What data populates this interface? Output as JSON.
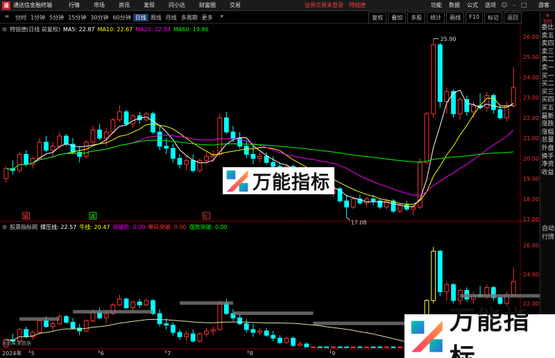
{
  "titlebar": {
    "app_title": "通达信金融终端",
    "menus": [
      "行情",
      "市场",
      "资讯",
      "发现",
      "问小达",
      "财富圈",
      "交易"
    ],
    "notice": "证券交易未登录",
    "notice2": "特锐德",
    "right_menus": [
      "功能",
      "数据",
      "公式",
      "选项"
    ],
    "guest": "游客"
  },
  "toolbar": {
    "periods": [
      "分时",
      "1分钟",
      "5分钟",
      "15分钟",
      "30分钟",
      "60分钟",
      "日线",
      "周线",
      "月线",
      "多周期",
      "更多"
    ],
    "active_period": "日线",
    "right_tools": [
      "复权",
      "叠加",
      "多股",
      "统计",
      "画线",
      "F10",
      "标记",
      "返回"
    ]
  },
  "main_legend": {
    "stock": "特锐德(日线 前复权)",
    "ma5": "MA5: 22.87",
    "ma10": "MA10: 22.67",
    "ma20": "MA20: 22.54",
    "ma60": "MA60: 19.86"
  },
  "sub_legend": {
    "name": "股票指标网",
    "zhuya": "撑压线: 22.57",
    "niuxian": "牛线: 20.47",
    "tupo": "突破阶: 0.00",
    "meiyin": "筹码突破: 0.00",
    "qiangshi": "强势突破: 0.00"
  },
  "price_axis": [
    "26.00",
    "25.00",
    "24.00",
    "23.00",
    "22.00",
    "21.00",
    "20.00",
    "19.00",
    "18.00",
    "17.00"
  ],
  "sub_axis": [
    "26.00",
    "24.00",
    "22.00",
    "20.00"
  ],
  "date_axis": [
    "2024年",
    "5",
    "6",
    "7",
    "8",
    "9",
    "10"
  ],
  "annotations": {
    "high": "25.90",
    "low": "17.08"
  },
  "markers": [
    "调",
    "减",
    "S",
    "财"
  ],
  "sidebar_items": [
    "委比",
    "卖五",
    "卖四",
    "卖三",
    "卖二",
    "卖一",
    "买一",
    "买二",
    "买三",
    "买四",
    "买五",
    "最新",
    "涨跌",
    "涨幅",
    "总量",
    "外盘",
    "换手",
    "净资",
    "收益"
  ],
  "sidebar_items2": [
    "自动",
    "行情"
  ],
  "sidebar_top": "R\n500",
  "footer_note": "同到未来数据",
  "watermark": "万能指标",
  "colors": {
    "up": "#ff3333",
    "down": "#00ffff",
    "ma5": "#ffffff",
    "ma10": "#ffff00",
    "ma20": "#ff00ff",
    "ma60": "#00ff00"
  },
  "chart_data": {
    "type": "candlestick",
    "ylim": [
      17.0,
      26.2
    ],
    "ohlc": [
      [
        19.0,
        19.6,
        18.8,
        19.5
      ],
      [
        19.5,
        19.9,
        19.2,
        19.4
      ],
      [
        19.4,
        20.3,
        19.3,
        20.2
      ],
      [
        20.2,
        20.4,
        19.6,
        19.7
      ],
      [
        19.7,
        20.1,
        19.5,
        20.0
      ],
      [
        20.0,
        21.0,
        19.9,
        20.8
      ],
      [
        20.8,
        21.1,
        20.3,
        20.4
      ],
      [
        20.4,
        20.8,
        20.1,
        20.6
      ],
      [
        20.6,
        21.3,
        20.5,
        21.1
      ],
      [
        21.1,
        21.2,
        20.6,
        20.7
      ],
      [
        20.7,
        21.0,
        20.2,
        20.3
      ],
      [
        20.3,
        20.6,
        19.8,
        20.1
      ],
      [
        20.1,
        20.9,
        20.0,
        20.8
      ],
      [
        20.8,
        21.6,
        20.7,
        21.4
      ],
      [
        21.4,
        21.7,
        20.9,
        21.0
      ],
      [
        21.0,
        21.5,
        20.6,
        21.3
      ],
      [
        21.3,
        22.0,
        21.2,
        21.9
      ],
      [
        21.9,
        22.6,
        21.8,
        22.3
      ],
      [
        22.3,
        22.4,
        21.6,
        21.7
      ],
      [
        21.7,
        22.2,
        21.5,
        22.1
      ],
      [
        22.1,
        22.3,
        21.7,
        21.9
      ],
      [
        21.9,
        22.3,
        21.8,
        22.2
      ],
      [
        22.2,
        22.3,
        21.2,
        21.3
      ],
      [
        21.3,
        21.6,
        20.4,
        20.6
      ],
      [
        20.6,
        21.0,
        20.2,
        20.5
      ],
      [
        20.5,
        20.7,
        19.8,
        20.0
      ],
      [
        20.0,
        20.2,
        19.5,
        19.7
      ],
      [
        19.7,
        20.1,
        19.4,
        19.9
      ],
      [
        19.9,
        20.2,
        19.3,
        19.4
      ],
      [
        19.4,
        20.0,
        19.3,
        19.9
      ],
      [
        19.9,
        20.3,
        19.7,
        20.1
      ],
      [
        20.1,
        20.4,
        19.8,
        20.2
      ],
      [
        20.2,
        22.2,
        20.1,
        22.0
      ],
      [
        22.0,
        22.3,
        21.2,
        21.3
      ],
      [
        21.3,
        21.6,
        20.8,
        21.0
      ],
      [
        21.0,
        21.3,
        20.5,
        20.6
      ],
      [
        20.6,
        20.9,
        20.0,
        20.2
      ],
      [
        20.2,
        20.6,
        19.7,
        20.0
      ],
      [
        20.0,
        20.3,
        19.8,
        20.1
      ],
      [
        20.1,
        20.3,
        19.7,
        19.8
      ],
      [
        19.8,
        20.1,
        19.4,
        19.6
      ],
      [
        19.6,
        19.8,
        19.2,
        19.3
      ],
      [
        19.3,
        19.7,
        19.2,
        19.6
      ],
      [
        19.6,
        19.7,
        19.0,
        19.1
      ],
      [
        19.1,
        19.4,
        18.8,
        19.2
      ],
      [
        19.2,
        19.3,
        18.6,
        18.7
      ],
      [
        18.7,
        19.0,
        18.5,
        18.9
      ],
      [
        18.9,
        19.0,
        18.4,
        18.5
      ],
      [
        18.5,
        18.7,
        18.2,
        18.3
      ],
      [
        18.3,
        18.6,
        18.1,
        18.5
      ],
      [
        18.5,
        18.6,
        17.8,
        17.9
      ],
      [
        17.9,
        18.2,
        17.08,
        17.6
      ],
      [
        17.6,
        18.1,
        17.5,
        18.0
      ],
      [
        18.0,
        18.2,
        17.7,
        17.8
      ],
      [
        17.8,
        18.1,
        17.6,
        18.0
      ],
      [
        18.0,
        18.2,
        17.7,
        17.9
      ],
      [
        17.9,
        18.0,
        17.5,
        17.6
      ],
      [
        17.6,
        18.0,
        17.5,
        17.9
      ],
      [
        17.9,
        18.0,
        17.3,
        17.4
      ],
      [
        17.4,
        17.8,
        17.3,
        17.7
      ],
      [
        17.7,
        17.9,
        17.4,
        17.5
      ],
      [
        17.5,
        17.7,
        17.2,
        17.6
      ],
      [
        17.6,
        20.0,
        17.5,
        19.8
      ],
      [
        19.8,
        22.3,
        19.7,
        22.2
      ],
      [
        22.2,
        25.9,
        22.0,
        25.6
      ],
      [
        25.6,
        25.7,
        22.5,
        22.8
      ],
      [
        22.8,
        23.5,
        22.2,
        23.3
      ],
      [
        23.3,
        23.4,
        22.0,
        22.2
      ],
      [
        22.2,
        23.0,
        21.9,
        22.9
      ],
      [
        22.9,
        23.1,
        22.1,
        22.3
      ],
      [
        22.3,
        22.8,
        22.0,
        22.6
      ],
      [
        22.6,
        23.2,
        22.4,
        22.5
      ],
      [
        22.5,
        23.3,
        22.3,
        23.1
      ],
      [
        23.1,
        23.2,
        22.2,
        22.4
      ],
      [
        22.4,
        22.6,
        21.9,
        22.0
      ],
      [
        22.0,
        22.8,
        21.8,
        22.6
      ],
      [
        22.6,
        24.5,
        22.5,
        23.5
      ]
    ],
    "ma5_last": 22.87,
    "ma10_last": 22.67,
    "ma20_last": 22.54,
    "ma60_last": 19.86
  }
}
